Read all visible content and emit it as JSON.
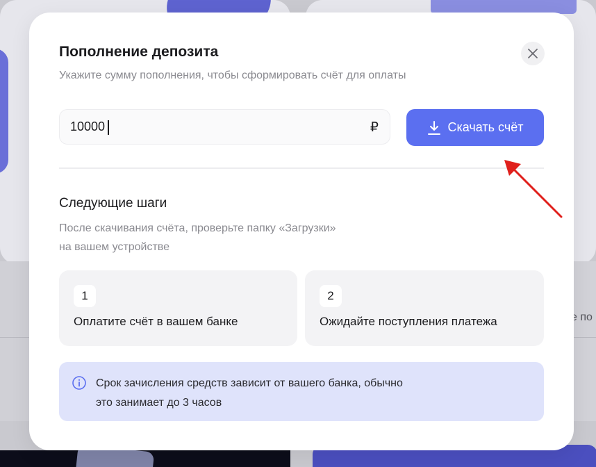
{
  "modal": {
    "title": "Пополнение депозита",
    "subtitle": "Укажите сумму пополнения, чтобы сформировать счёт для оплаты",
    "close_icon": "close-icon"
  },
  "amount": {
    "value": "10000",
    "currency": "₽"
  },
  "download": {
    "label": "Скачать счёт",
    "icon": "download-icon"
  },
  "next_steps": {
    "title": "Следующие шаги",
    "description_line1": "После скачивания счёта, проверьте папку «Загрузки»",
    "description_line2": "на вашем устройстве",
    "steps": [
      {
        "number": "1",
        "text": "Оплатите счёт в вашем банке"
      },
      {
        "number": "2",
        "text": "Ожидайте поступления платежа"
      }
    ]
  },
  "info": {
    "icon": "info-icon",
    "line1": "Срок зачисления средств зависит от вашего банка, обычно",
    "line2": "это занимает до 3 часов"
  },
  "background": {
    "partial_text": "е по"
  },
  "colors": {
    "accent": "#5b6ff0",
    "info_bg": "#dfe3fb",
    "annotation": "#e0201c"
  }
}
